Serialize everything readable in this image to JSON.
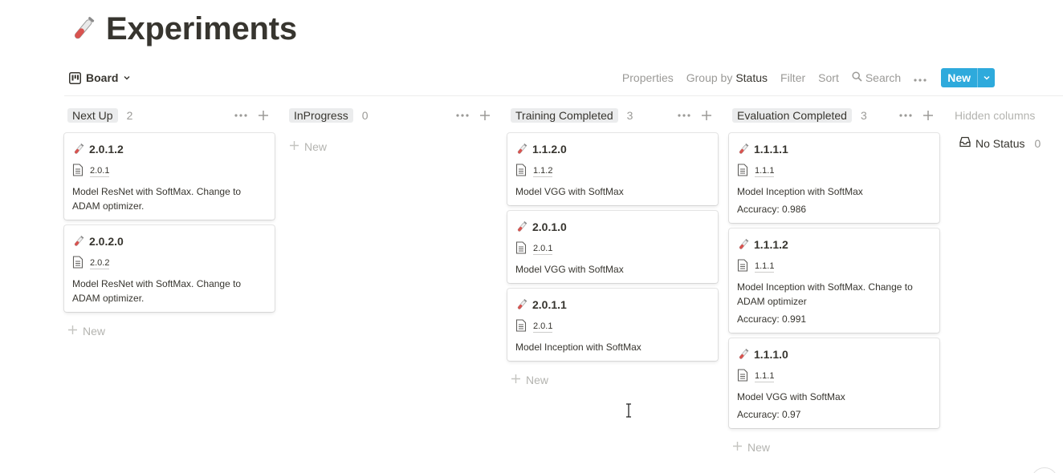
{
  "page": {
    "title": "Experiments",
    "icon": "test-tube-icon"
  },
  "toolbar": {
    "view_label": "Board",
    "properties": "Properties",
    "group_by_prefix": "Group by",
    "group_by_value": "Status",
    "filter": "Filter",
    "sort": "Sort",
    "search": "Search",
    "new_label": "New"
  },
  "columns": [
    {
      "name": "Next Up",
      "count": "2",
      "add_label": "New",
      "cards": [
        {
          "title": "2.0.1.2",
          "ref": "2.0.1",
          "desc": "Model ResNet with SoftMax. Change to ADAM optimizer.",
          "accuracy": ""
        },
        {
          "title": "2.0.2.0",
          "ref": "2.0.2",
          "desc": "Model ResNet with SoftMax. Change to ADAM optimizer.",
          "accuracy": ""
        }
      ]
    },
    {
      "name": "InProgress",
      "count": "0",
      "add_label": "New",
      "cards": []
    },
    {
      "name": "Training Completed",
      "count": "3",
      "add_label": "New",
      "cards": [
        {
          "title": "1.1.2.0",
          "ref": "1.1.2",
          "desc": "Model VGG with SoftMax",
          "accuracy": ""
        },
        {
          "title": "2.0.1.0",
          "ref": "2.0.1",
          "desc": "Model VGG with SoftMax",
          "accuracy": ""
        },
        {
          "title": "2.0.1.1",
          "ref": "2.0.1",
          "desc": "Model Inception with SoftMax",
          "accuracy": ""
        }
      ]
    },
    {
      "name": "Evaluation Completed",
      "count": "3",
      "add_label": "New",
      "cards": [
        {
          "title": "1.1.1.1",
          "ref": "1.1.1",
          "desc": "Model Inception with SoftMax",
          "accuracy": "Accuracy: 0.986"
        },
        {
          "title": "1.1.1.2",
          "ref": "1.1.1",
          "desc": "Model Inception with SoftMax. Change to ADAM optimizer",
          "accuracy": "Accuracy: 0.991"
        },
        {
          "title": "1.1.1.0",
          "ref": "1.1.1",
          "desc": "Model VGG with SoftMax",
          "accuracy": "Accuracy: 0.97"
        }
      ]
    }
  ],
  "hidden_columns": {
    "title": "Hidden columns",
    "items": [
      {
        "name": "No Status",
        "count": "0"
      }
    ]
  },
  "colors": {
    "accent": "#2eaadc",
    "text": "#37352f",
    "muted": "#9b9a97",
    "pill": "#ebeced"
  }
}
